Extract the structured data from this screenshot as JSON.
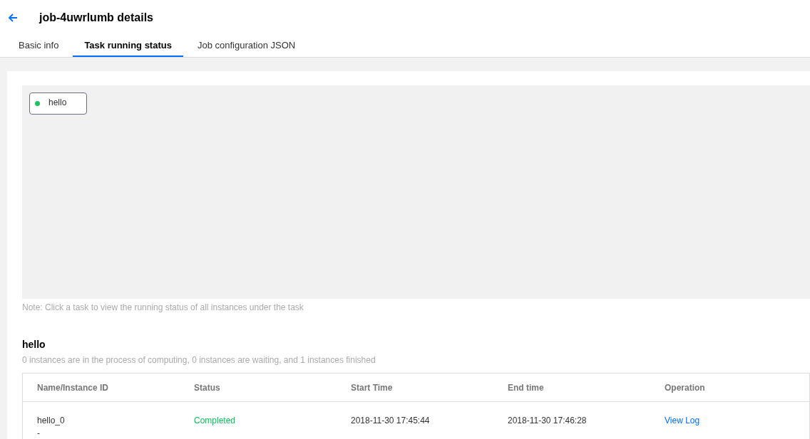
{
  "header": {
    "title": "job-4uwrlumb details"
  },
  "tabs": [
    {
      "label": "Basic info",
      "selected": false
    },
    {
      "label": "Task running status",
      "selected": true
    },
    {
      "label": "Job configuration JSON",
      "selected": false
    }
  ],
  "task_graph": {
    "nodes": [
      {
        "label": "hello",
        "color": "#1ec55e"
      }
    ],
    "note": "Note: Click a task to view the running status of all instances under the task"
  },
  "task_detail": {
    "title": "hello",
    "summary": "0 instances are in the process of computing, 0 instances are waiting, and 1 instances finished"
  },
  "table": {
    "columns": [
      "Name/Instance ID",
      "Status",
      "Start Time",
      "End time",
      "Operation"
    ],
    "rows": [
      {
        "name": "hello_0",
        "instance_id": "-",
        "status": "Completed",
        "kind": "success",
        "start_time": "2018-11-30 17:45:44",
        "end_time": "2018-11-30 17:46:28",
        "operation": "View Log"
      }
    ]
  }
}
